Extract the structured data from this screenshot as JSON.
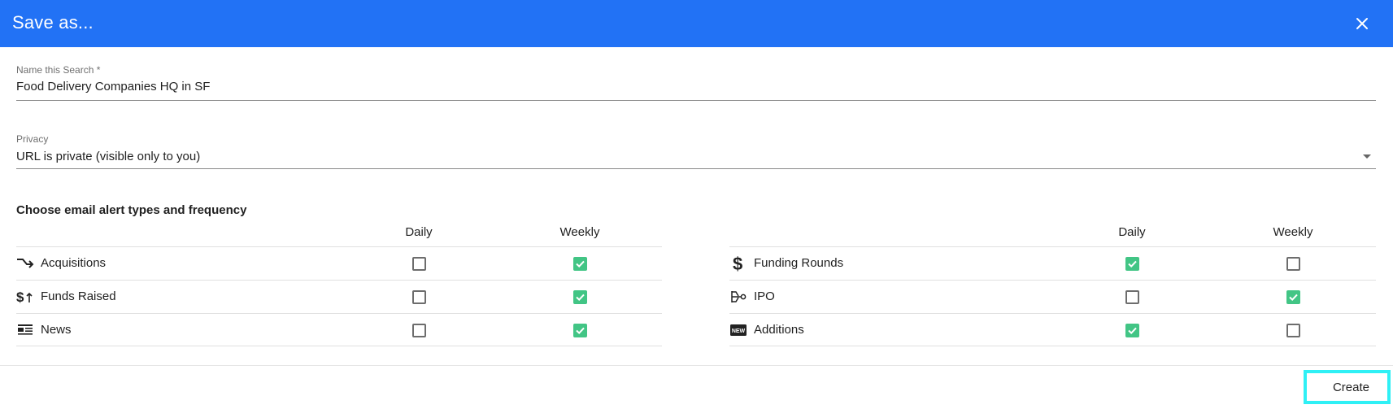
{
  "dialog": {
    "title": "Save as...",
    "close_icon": "close-icon"
  },
  "name_field": {
    "label": "Name this Search *",
    "value": "Food Delivery Companies HQ in SF"
  },
  "privacy_field": {
    "label": "Privacy",
    "value": "URL is private (visible only to you)"
  },
  "alerts": {
    "title": "Choose email alert types and frequency",
    "daily_header": "Daily",
    "weekly_header": "Weekly",
    "left": [
      {
        "label": "Acquisitions",
        "icon": "acquisitions-icon",
        "daily": false,
        "weekly": true
      },
      {
        "label": "Funds Raised",
        "icon": "funds-raised-icon",
        "daily": false,
        "weekly": true
      },
      {
        "label": "News",
        "icon": "news-icon",
        "daily": false,
        "weekly": true
      }
    ],
    "right": [
      {
        "label": "Funding Rounds",
        "icon": "dollar-icon",
        "daily": true,
        "weekly": false
      },
      {
        "label": "IPO",
        "icon": "ipo-icon",
        "daily": false,
        "weekly": true
      },
      {
        "label": "Additions",
        "icon": "new-badge-icon",
        "daily": true,
        "weekly": false
      }
    ]
  },
  "footer": {
    "create_label": "Create"
  },
  "colors": {
    "header_bg": "#2272f5",
    "checked": "#42c585",
    "focus_outline": "#2ff0f5"
  }
}
